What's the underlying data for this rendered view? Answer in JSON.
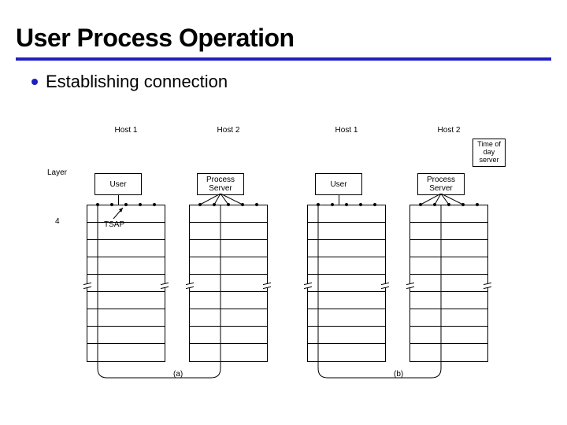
{
  "title": "User Process Operation",
  "bullet": "Establishing connection",
  "hosts": {
    "h1": "Host 1",
    "h2": "Host 2"
  },
  "tod": "Time of day server",
  "layer_label": "Layer",
  "entities": {
    "user": "User",
    "ps": "Process Server"
  },
  "layer_num": "4",
  "tsap": "TSAP",
  "fig": {
    "a": "(a)",
    "b": "(b)"
  }
}
